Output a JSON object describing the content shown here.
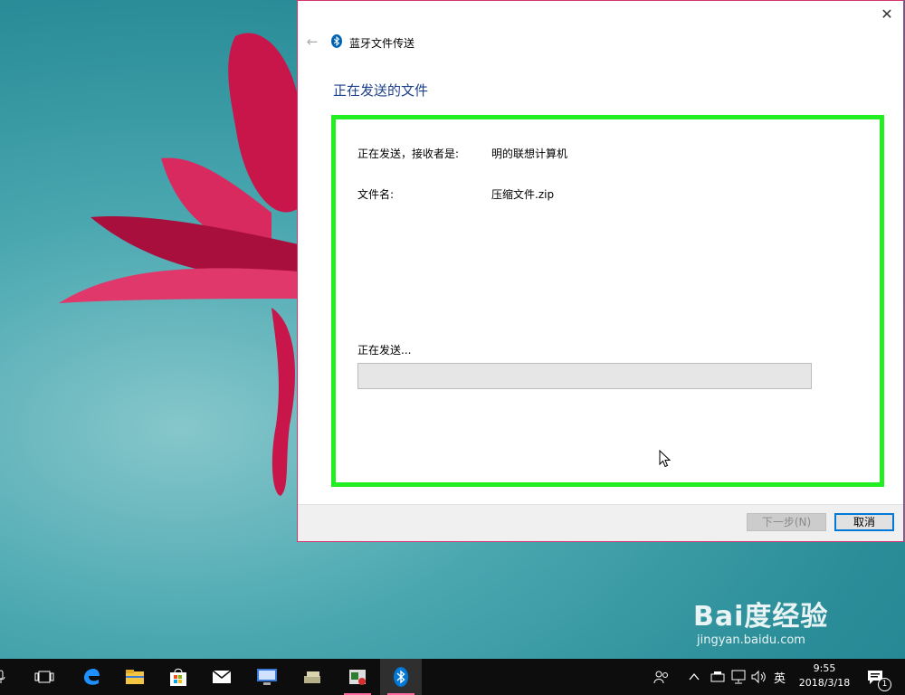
{
  "dialog": {
    "title": "蓝牙文件传送",
    "heading": "正在发送的文件",
    "close_symbol": "✕",
    "back_symbol": "←",
    "recipient_label": "正在发送，接收者是:",
    "recipient_value": "明的联想计算机",
    "filename_label": "文件名:",
    "filename_value": "压缩文件.zip",
    "status_text": "正在发送...",
    "progress_percent": 0,
    "next_button": "下一步(N)",
    "cancel_button": "取消"
  },
  "taskbar": {
    "clock_time": "9:55",
    "clock_date": "2018/3/18",
    "ime_label": "英",
    "notification_count": "1"
  },
  "watermark": {
    "main": "Bai度经验",
    "sub": "jingyan.baidu.com"
  },
  "colors": {
    "highlight_border": "#22ee22",
    "dialog_border": "#d6336f",
    "heading": "#1c3f8a",
    "taskbar": "#0d0d0d"
  }
}
